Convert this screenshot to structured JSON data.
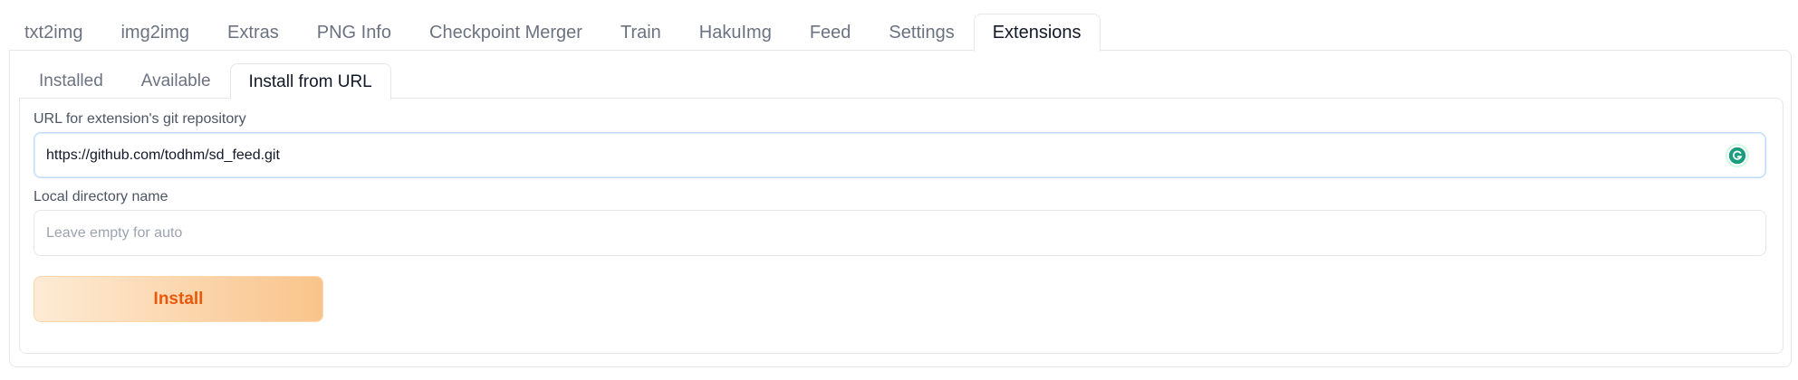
{
  "top_tabs": [
    {
      "label": "txt2img",
      "selected": false
    },
    {
      "label": "img2img",
      "selected": false
    },
    {
      "label": "Extras",
      "selected": false
    },
    {
      "label": "PNG Info",
      "selected": false
    },
    {
      "label": "Checkpoint Merger",
      "selected": false
    },
    {
      "label": "Train",
      "selected": false
    },
    {
      "label": "HakuImg",
      "selected": false
    },
    {
      "label": "Feed",
      "selected": false
    },
    {
      "label": "Settings",
      "selected": false
    },
    {
      "label": "Extensions",
      "selected": true
    }
  ],
  "sub_tabs": [
    {
      "label": "Installed",
      "selected": false
    },
    {
      "label": "Available",
      "selected": false
    },
    {
      "label": "Install from URL",
      "selected": true
    }
  ],
  "url_field": {
    "label": "URL for extension's git repository",
    "value": "https://github.com/todhm/sd_feed.git",
    "extension_icon": "grammarly-icon"
  },
  "dir_field": {
    "label": "Local directory name",
    "placeholder": "Leave empty for auto",
    "value": ""
  },
  "install_button": {
    "label": "Install"
  },
  "colors": {
    "accent": "#ea580c",
    "button_gradient_start": "#fdebd5",
    "button_gradient_end": "#f9c48b",
    "focus_border": "#bfdbfe",
    "grammarly": "#1a9e7e"
  }
}
